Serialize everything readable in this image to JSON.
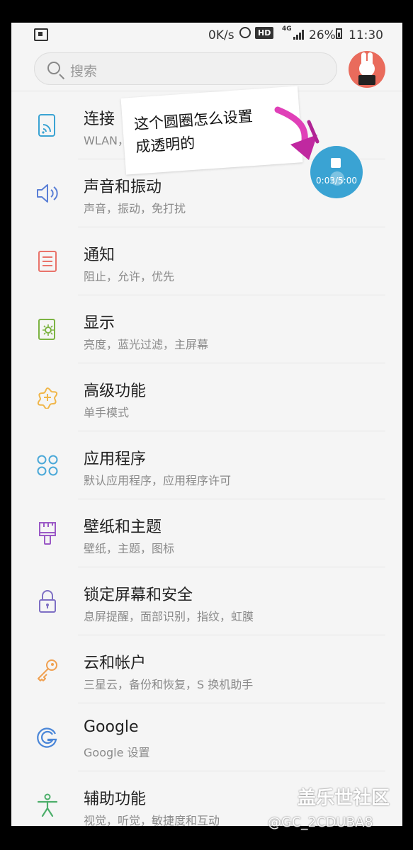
{
  "status_bar": {
    "net_speed": "0K/s",
    "hd_label": "HD",
    "network_type": "4G",
    "battery": "26%",
    "time": "11:30"
  },
  "search": {
    "placeholder": "搜索"
  },
  "items": [
    {
      "title": "连接",
      "subtitle": "WLAN，蓝牙，飞行模式",
      "icon": "connections-icon",
      "color": "#3aa3d3"
    },
    {
      "title": "声音和振动",
      "subtitle": "声音，振动，免打扰",
      "icon": "sound-icon",
      "color": "#5a7fd6"
    },
    {
      "title": "通知",
      "subtitle": "阻止，允许，优先",
      "icon": "notifications-icon",
      "color": "#e9736a"
    },
    {
      "title": "显示",
      "subtitle": "亮度，蓝光过滤，主屏幕",
      "icon": "display-icon",
      "color": "#7cb342"
    },
    {
      "title": "高级功能",
      "subtitle": "单手模式",
      "icon": "advanced-features-icon",
      "color": "#f0b64a"
    },
    {
      "title": "应用程序",
      "subtitle": "默认应用程序，应用程序许可",
      "icon": "apps-icon",
      "color": "#4aa8d8"
    },
    {
      "title": "壁纸和主题",
      "subtitle": "壁纸，主题，图标",
      "icon": "wallpaper-icon",
      "color": "#9b59c6"
    },
    {
      "title": "锁定屏幕和安全",
      "subtitle": "息屏提醒，面部识别，指纹，虹膜",
      "icon": "lock-icon",
      "color": "#7e6fc4"
    },
    {
      "title": "云和帐户",
      "subtitle": "三星云，备份和恢复，S 换机助手",
      "icon": "key-icon",
      "color": "#f0a050"
    },
    {
      "title": "Google",
      "subtitle": "Google 设置",
      "icon": "google-icon",
      "color": "#4a86d8"
    },
    {
      "title": "辅助功能",
      "subtitle": "视觉，听觉，敏捷度和互动",
      "icon": "accessibility-icon",
      "color": "#4cae6a"
    }
  ],
  "note": {
    "line1": "这个圆圈怎么设置",
    "line2": "成透明的"
  },
  "recorder": {
    "timer": "0:03/5:00"
  },
  "watermark": {
    "site": "盖乐世社区",
    "user": "@GC_2CDUBA8"
  }
}
